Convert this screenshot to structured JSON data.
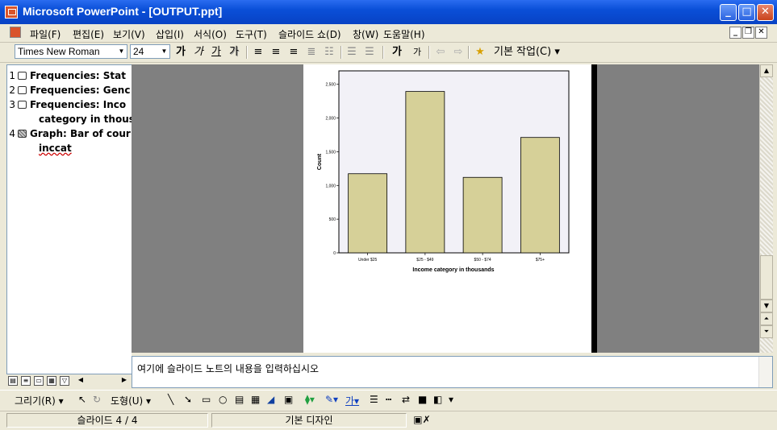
{
  "window": {
    "title": "Microsoft PowerPoint - [OUTPUT.ppt]"
  },
  "menubar": {
    "items": [
      "파일(F)",
      "편집(E)",
      "보기(V)",
      "삽입(I)",
      "서식(O)",
      "도구(T)",
      "슬라이드 쇼(D)",
      "창(W)",
      "도움말(H)"
    ]
  },
  "format_toolbar": {
    "font_name": "Times New Roman",
    "font_size": "24",
    "bold": "가",
    "italic": "가",
    "underline": "가",
    "shadow": "가",
    "grow_font": "가",
    "shrink_font": "가",
    "task_label": "기본 작업(C)"
  },
  "outline": {
    "items": [
      {
        "num": "1",
        "text": "Frequencies: Stat",
        "cont": ""
      },
      {
        "num": "2",
        "text": "Frequencies: Genc",
        "cont": ""
      },
      {
        "num": "3",
        "text": "Frequencies: Inco",
        "cont": "category in thous"
      },
      {
        "num": "4",
        "text": "Graph: Bar of cour",
        "cont": "inccat"
      }
    ]
  },
  "notes": {
    "placeholder": "여기에 슬라이드 노트의 내용을 입력하십시오"
  },
  "drawing_toolbar": {
    "draw_label": "그리기(R)",
    "autoshapes_label": "도형(U)"
  },
  "statusbar": {
    "slide": "슬라이드 4 / 4",
    "design": "기본 디자인"
  },
  "chart_data": {
    "type": "bar",
    "categories": [
      "Under $25",
      "$25 - $49",
      "$50 - $74",
      "$75+"
    ],
    "values": [
      1174,
      2394,
      1120,
      1712
    ],
    "xlabel": "Income category in thousands",
    "ylabel": "Count",
    "ylim": [
      0,
      2700
    ],
    "yticks": [
      "0",
      "500",
      "1,000",
      "1,500",
      "2,000",
      "2,500"
    ],
    "bar_color": "#d6d098",
    "plot_bg": "#f2f1f7"
  }
}
